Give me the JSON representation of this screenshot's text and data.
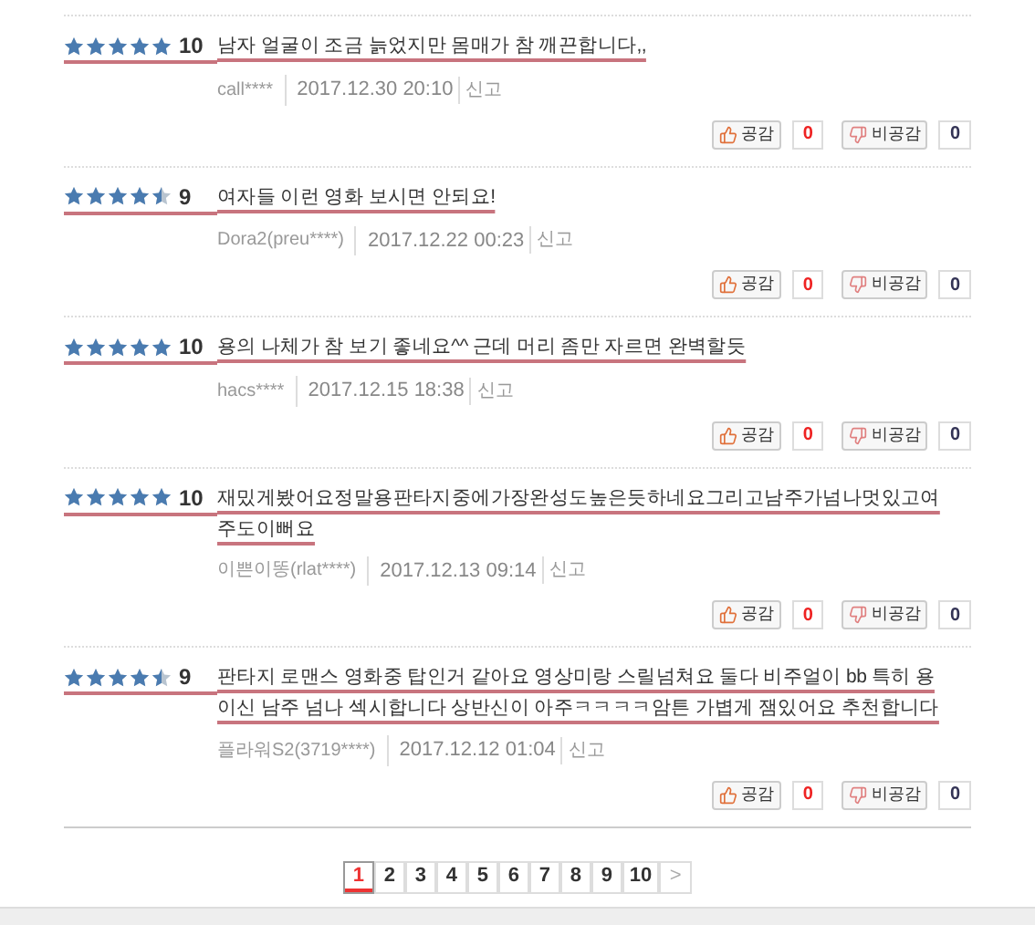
{
  "reviews": [
    {
      "stars": 5,
      "score": "10",
      "comment": "남자 얼굴이 조금 늙었지만 몸매가 참 깨끈합니다,,",
      "author": "call****",
      "date": "2017.12.30 20:10",
      "report": "신고",
      "like_label": "공감",
      "like_count": "0",
      "dislike_label": "비공감",
      "dislike_count": "0"
    },
    {
      "stars": 4.5,
      "score": "9",
      "comment": "여자들 이런 영화 보시면 안되요!",
      "author": "Dora2(preu****)",
      "date": "2017.12.22 00:23",
      "report": "신고",
      "like_label": "공감",
      "like_count": "0",
      "dislike_label": "비공감",
      "dislike_count": "0"
    },
    {
      "stars": 5,
      "score": "10",
      "comment": "용의 나체가 참 보기 좋네요^^ 근데 머리 좀만 자르면 완벽할듯",
      "author": "hacs****",
      "date": "2017.12.15 18:38",
      "report": "신고",
      "like_label": "공감",
      "like_count": "0",
      "dislike_label": "비공감",
      "dislike_count": "0"
    },
    {
      "stars": 5,
      "score": "10",
      "comment": "재밌게봤어요정말용판타지중에가장완성도높은듯하네요그리고남주가넘나멋있고여주도이뻐요",
      "author": "이쁜이똥(rlat****)",
      "date": "2017.12.13 09:14",
      "report": "신고",
      "like_label": "공감",
      "like_count": "0",
      "dislike_label": "비공감",
      "dislike_count": "0"
    },
    {
      "stars": 4.5,
      "score": "9",
      "comment": "판타지 로맨스 영화중 탑인거 같아요 영상미랑 스릴넘쳐요 둘다 비주얼이 bb 특히 용이신 남주 넘나 섹시합니다 상반신이 아주ㅋㅋㅋㅋ암튼 가볍게 잼있어요 추천합니다",
      "author": "플라워S2(3719****)",
      "date": "2017.12.12 01:04",
      "report": "신고",
      "like_label": "공감",
      "like_count": "0",
      "dislike_label": "비공감",
      "dislike_count": "0"
    }
  ],
  "pagination": {
    "pages": [
      {
        "label": "1",
        "selected": true
      },
      {
        "label": "2",
        "selected": false
      },
      {
        "label": "3",
        "selected": false
      },
      {
        "label": "4",
        "selected": false
      },
      {
        "label": "5",
        "selected": false
      },
      {
        "label": "6",
        "selected": false
      },
      {
        "label": "7",
        "selected": false
      },
      {
        "label": "8",
        "selected": false
      },
      {
        "label": "9",
        "selected": false
      },
      {
        "label": "10",
        "selected": false
      }
    ],
    "next": ">"
  }
}
